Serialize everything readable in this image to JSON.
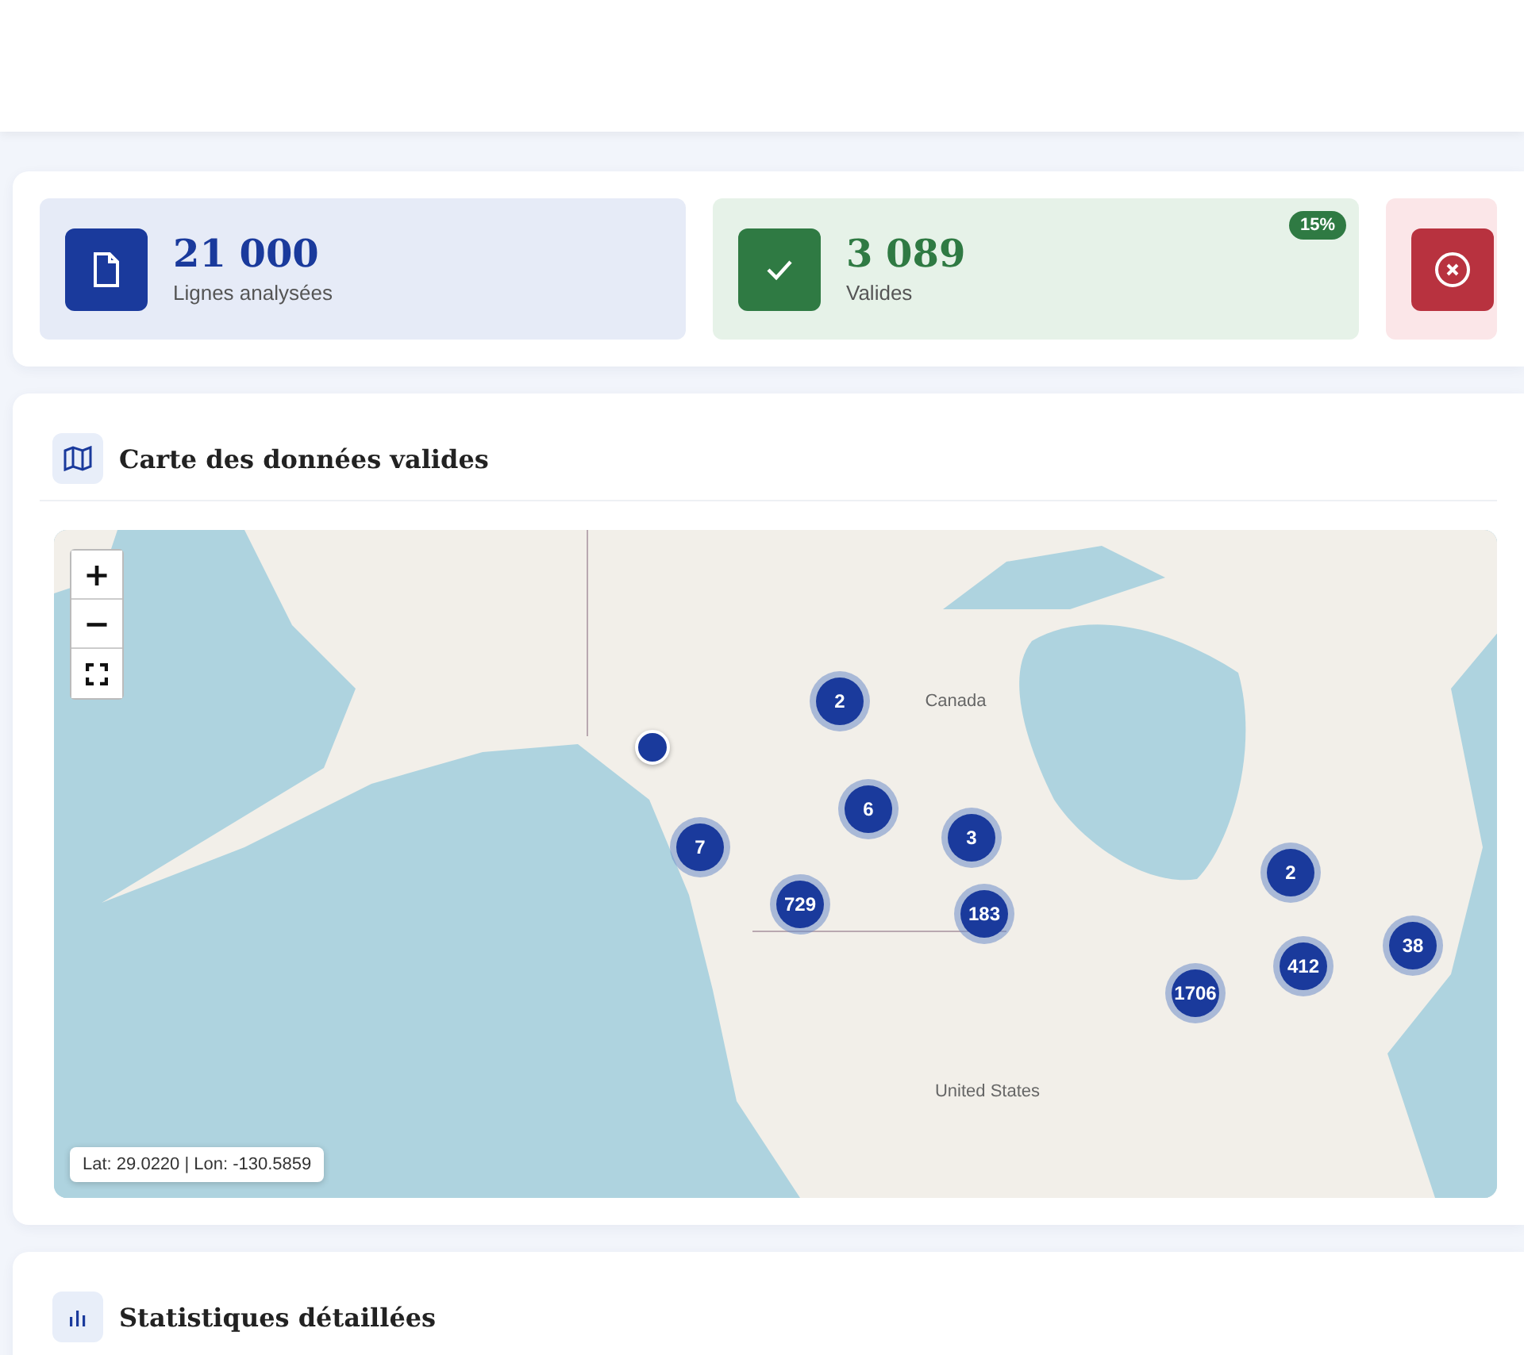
{
  "stats": [
    {
      "kind": "info",
      "value": "21 000",
      "label": "Lignes analysées"
    },
    {
      "kind": "success",
      "value": "3 089",
      "label": "Valides",
      "badge": "15%"
    },
    {
      "kind": "error"
    }
  ],
  "map_panel": {
    "title": "Carte des données valides",
    "controls": {
      "zoom_in": "+",
      "zoom_out": "−"
    },
    "place_labels": [
      "Canada",
      "United States"
    ],
    "clusters": [
      {
        "kind": "cluster",
        "label": "2"
      },
      {
        "kind": "marker"
      },
      {
        "kind": "cluster",
        "label": "7"
      },
      {
        "kind": "cluster",
        "label": "6"
      },
      {
        "kind": "cluster",
        "label": "3"
      },
      {
        "kind": "cluster",
        "label": "729"
      },
      {
        "kind": "cluster",
        "label": "183"
      },
      {
        "kind": "cluster",
        "label": "2"
      },
      {
        "kind": "cluster",
        "label": "412"
      },
      {
        "kind": "cluster",
        "label": "38"
      },
      {
        "kind": "cluster",
        "label": "1706"
      }
    ],
    "coordinates": "Lat: 29.0220 | Lon: -130.5859"
  },
  "stats_panel": {
    "title": "Statistiques détaillées"
  }
}
